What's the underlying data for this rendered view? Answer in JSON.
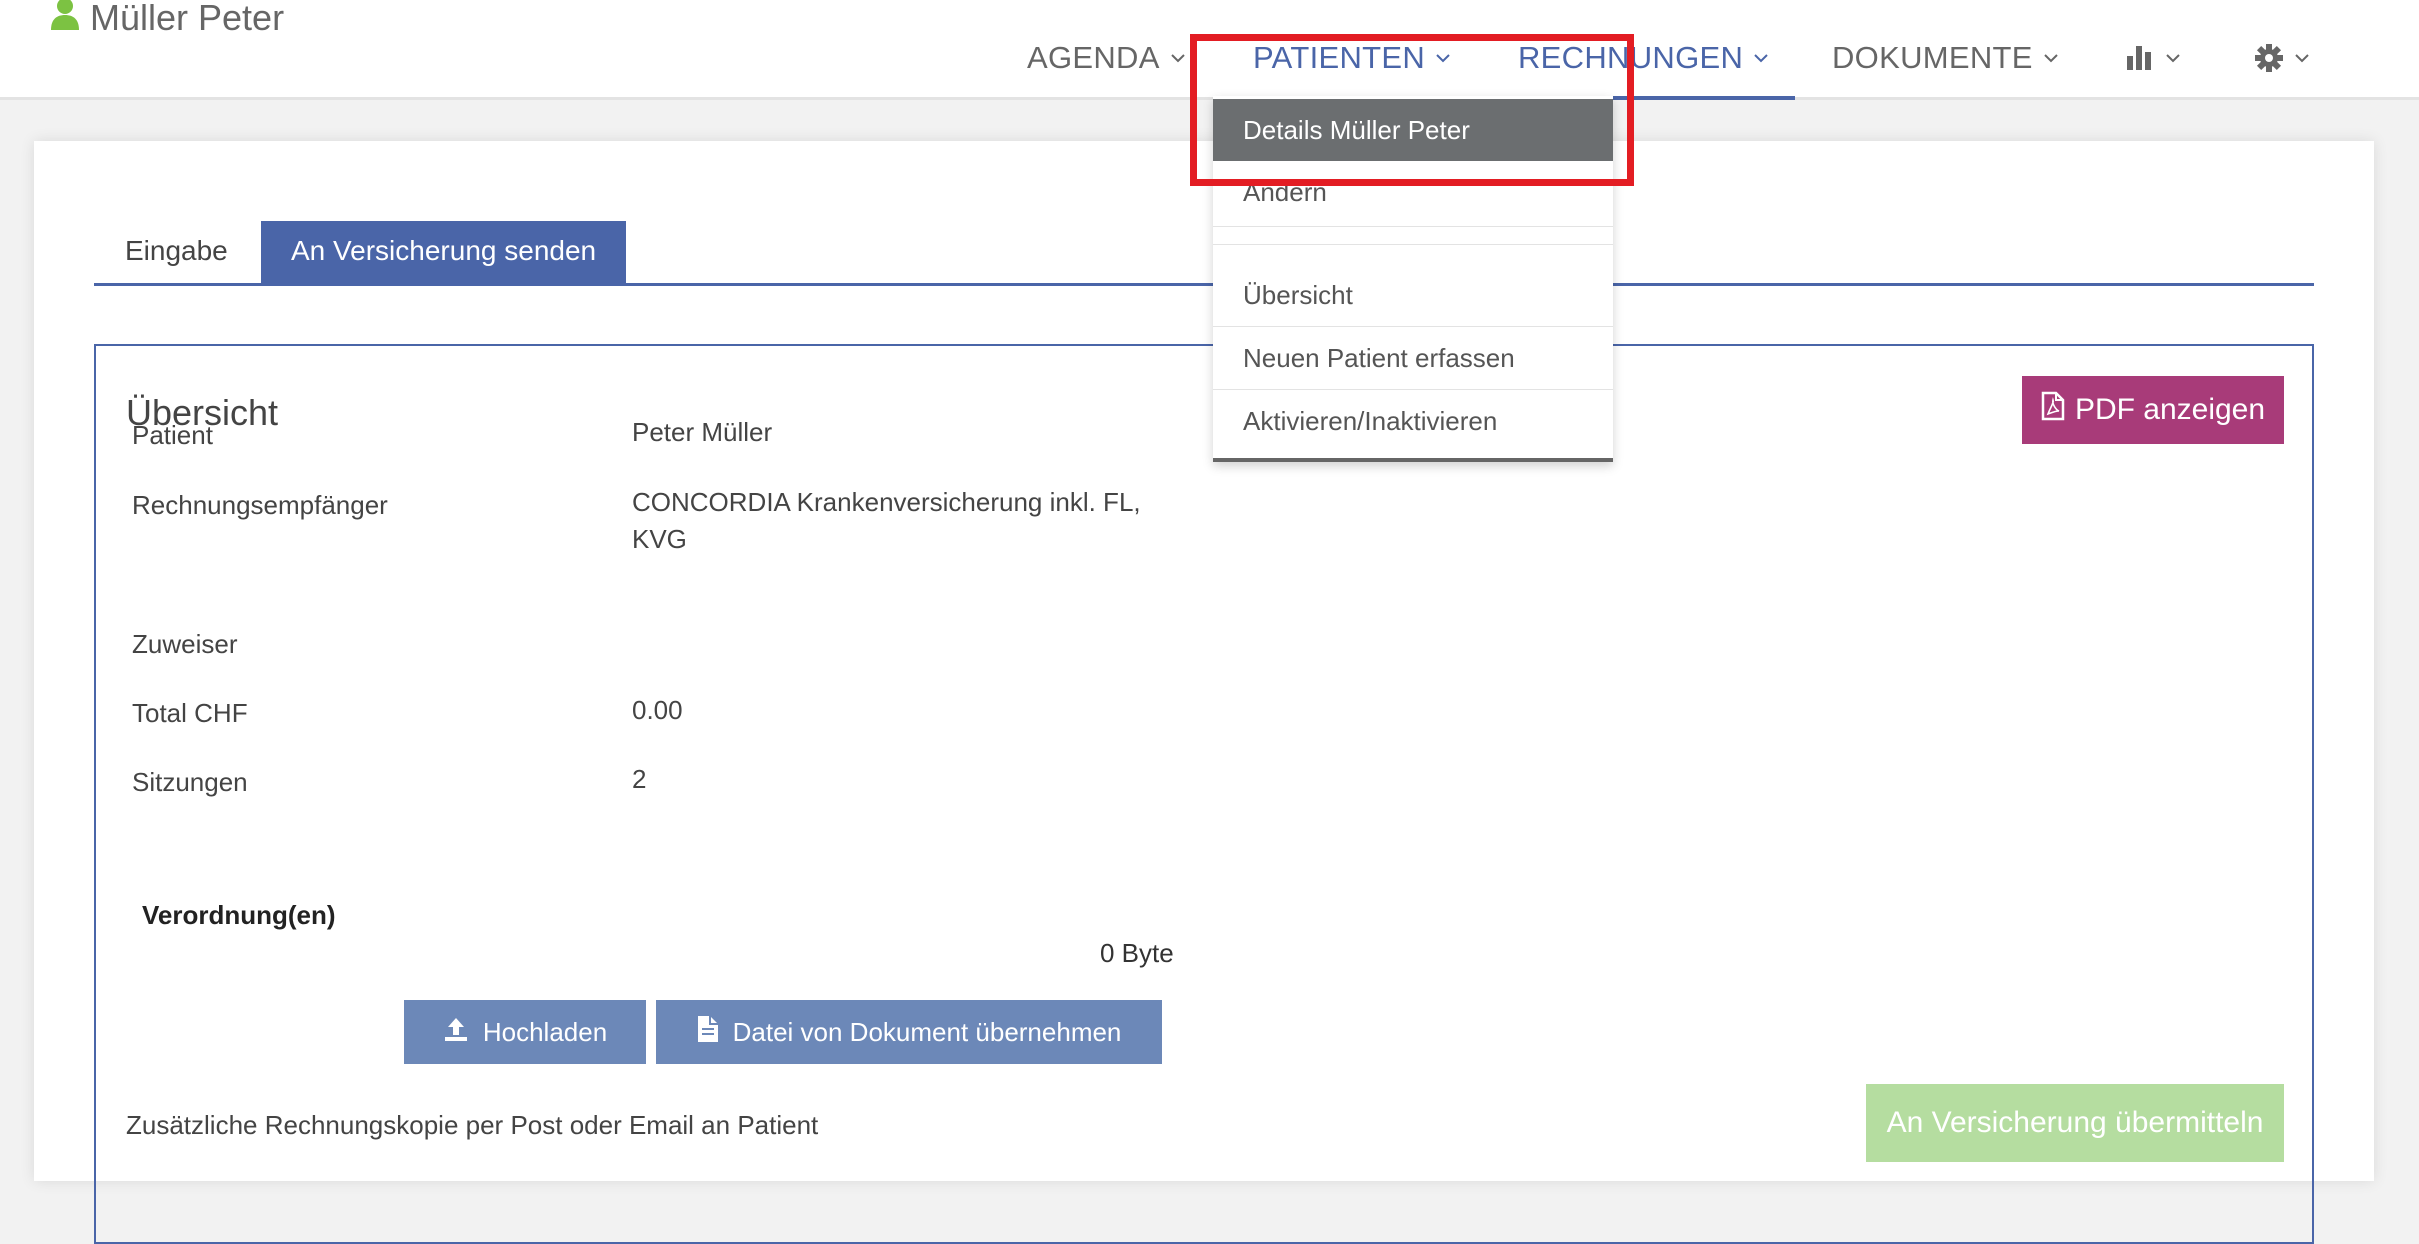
{
  "user": {
    "name": "Müller Peter",
    "icon": "user-icon",
    "icon_color": "#7cc242"
  },
  "nav": {
    "items": [
      {
        "label": "AGENDA"
      },
      {
        "label": "PATIENTEN"
      },
      {
        "label": "RECHNUNGEN"
      },
      {
        "label": "DOKUMENTE"
      }
    ],
    "chart_icon": "bar-chart-icon",
    "settings_icon": "gear-icon"
  },
  "tabs": [
    {
      "label": "Eingabe"
    },
    {
      "label": "An Versicherung senden"
    }
  ],
  "overview": {
    "title": "Übersicht",
    "pdf_button": "PDF anzeigen",
    "rows": [
      {
        "label": "Patient",
        "value": "Peter Müller"
      },
      {
        "label": "Rechnungsempfänger",
        "value": "CONCORDIA Krankenversicherung inkl. FL,",
        "value2": "KVG"
      },
      {
        "label": "Zuweiser",
        "value": ""
      },
      {
        "label": "Total CHF",
        "value": "0.00"
      },
      {
        "label": "Sitzungen",
        "value": "2"
      }
    ],
    "verordnungen_title": "Verordnung(en)",
    "bytes": "0 Byte",
    "upload_button": "Hochladen",
    "from_document_button": "Datei von Dokument übernehmen",
    "copy_text": "Zusätzliche Rechnungskopie per Post oder Email an Patient",
    "submit_button": "An Versicherung übermitteln"
  },
  "dropdown": {
    "items": [
      {
        "label": "Details Müller Peter"
      },
      {
        "label": "Ändern"
      },
      {
        "label": "Übersicht"
      },
      {
        "label": "Neuen Patient erfassen"
      },
      {
        "label": "Aktivieren/Inaktivieren"
      }
    ]
  },
  "colors": {
    "primary": "#4a65a8",
    "pdf": "#a83b79",
    "submit": "#b5dda0",
    "secondary_button": "#6c88b8",
    "highlight": "#e31d23"
  }
}
